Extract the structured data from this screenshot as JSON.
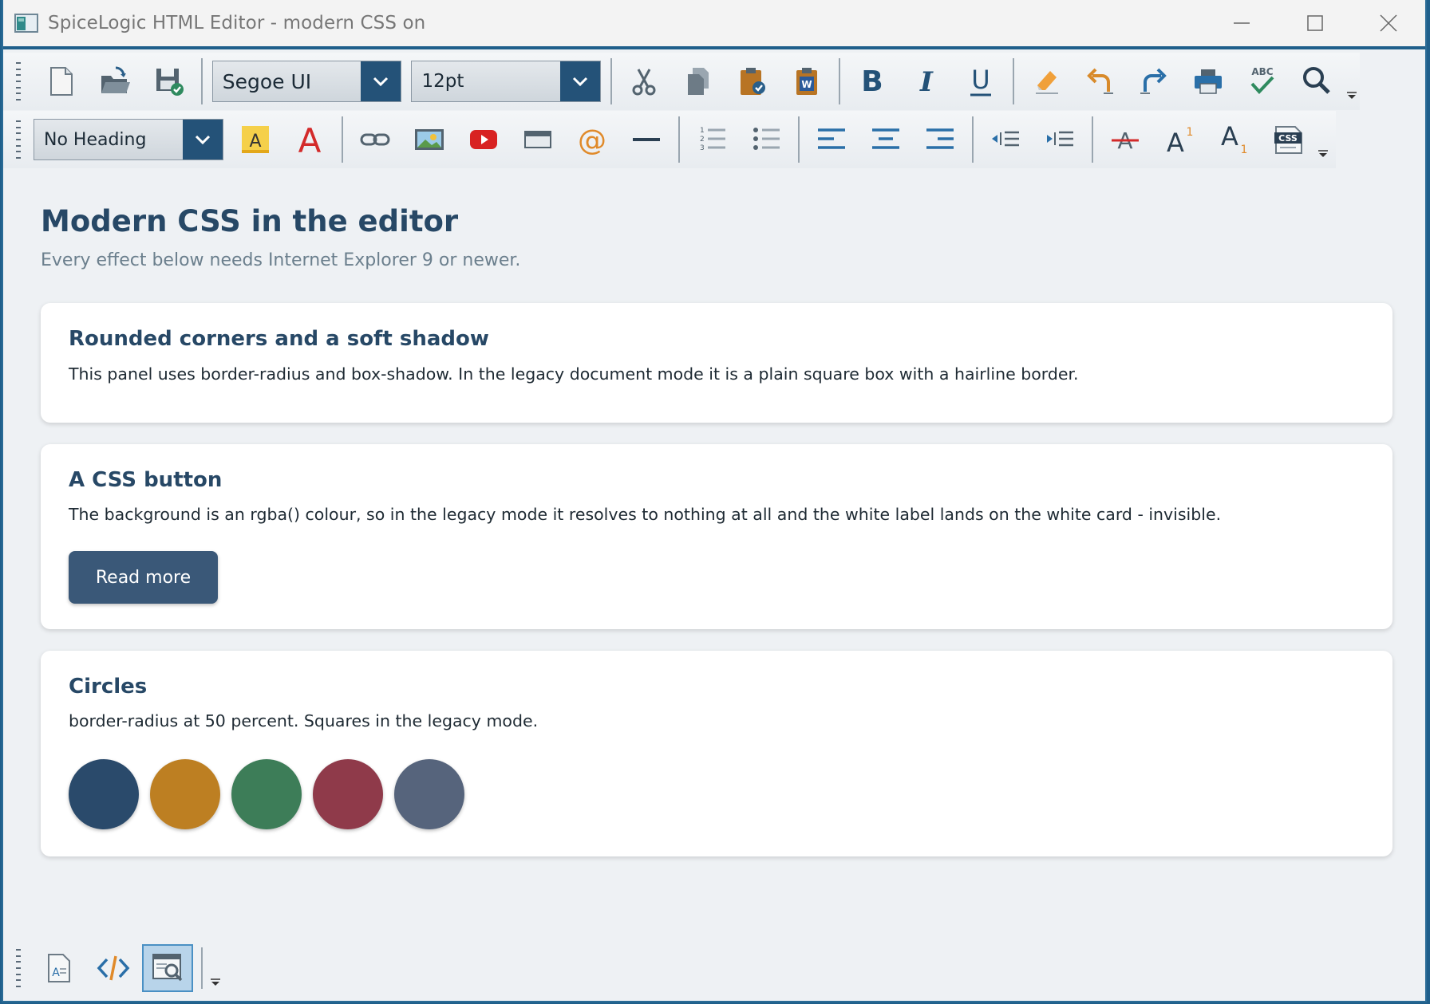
{
  "window": {
    "title": "SpiceLogic HTML Editor  -  modern CSS on"
  },
  "toolbar1": {
    "font_family": "Segoe UI",
    "font_size": "12pt",
    "spellcheck_label": "ABC"
  },
  "toolbar2": {
    "heading": "No Heading",
    "highlight_glyph": "A",
    "font_color_glyph": "A",
    "superscript_glyph": "A",
    "subscript_glyph": "A",
    "css_label": "CSS"
  },
  "document": {
    "title": "Modern CSS in the editor",
    "subtitle": "Every effect below needs Internet Explorer 9 or newer.",
    "cards": [
      {
        "heading": "Rounded corners and a soft shadow",
        "text": "This panel uses border-radius and box-shadow. In the legacy document mode it is a plain square box with a hairline border."
      },
      {
        "heading": "A CSS button",
        "text": "The background is an rgba() colour, so in the legacy mode it resolves to nothing at all and the white label lands on the white card - invisible.",
        "button_label": "Read more"
      },
      {
        "heading": "Circles",
        "text": "border-radius at 50 percent. Squares in the legacy mode.",
        "circle_colors": [
          "#2a4a6b",
          "#bd7f22",
          "#3d7d58",
          "#8f3a4a",
          "#56647c"
        ]
      }
    ]
  },
  "colors": {
    "accent": "#1f5f8b",
    "heading": "#274866",
    "button_bg": "#3a5878",
    "active_view": "#b8d4ea"
  }
}
